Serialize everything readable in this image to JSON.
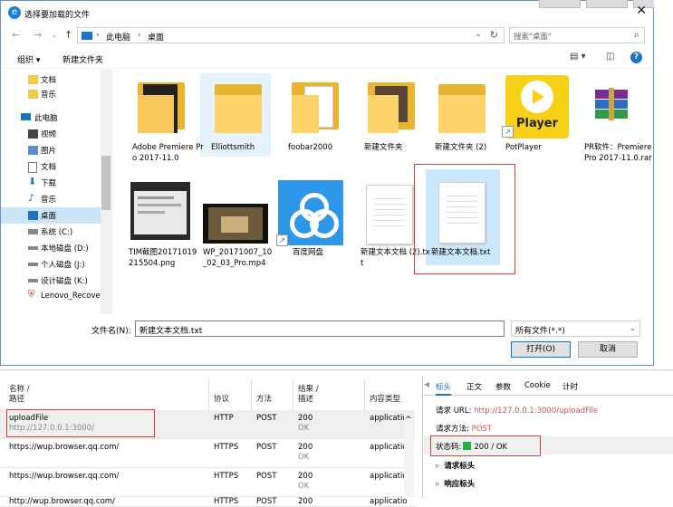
{
  "dialog": {
    "title": "选择要加载的文件",
    "close": "✕",
    "address": {
      "crumbs": [
        "此电脑",
        "桌面"
      ],
      "sep": "›"
    },
    "search_placeholder": "搜索\"桌面\"",
    "toolbar": {
      "organize": "组织 ▾",
      "new_folder": "新建文件夹"
    },
    "sidebar": [
      {
        "label": "文档",
        "icon": "folder-icon"
      },
      {
        "label": "音乐",
        "icon": "folder-icon"
      },
      {
        "label": "此电脑",
        "icon": "computer-icon"
      },
      {
        "label": "视频",
        "icon": "video-icon"
      },
      {
        "label": "图片",
        "icon": "picture-icon"
      },
      {
        "label": "文档",
        "icon": "document-icon"
      },
      {
        "label": "下载",
        "icon": "download-icon"
      },
      {
        "label": "音乐",
        "icon": "music-icon"
      },
      {
        "label": "桌面",
        "icon": "desktop-icon"
      },
      {
        "label": "系统 (C:)",
        "icon": "drive-icon"
      },
      {
        "label": "本地磁盘 (D:)",
        "icon": "drive-icon"
      },
      {
        "label": "个人磁盘 (J:)",
        "icon": "drive-icon"
      },
      {
        "label": "设计磁盘 (K:)",
        "icon": "drive-icon"
      },
      {
        "label": "Lenovo_Recove",
        "icon": "recovery-drive-icon"
      }
    ],
    "files": [
      {
        "name": "Adobe Premiere Pro 2017-11.0"
      },
      {
        "name": "Elliottsmith"
      },
      {
        "name": "foobar2000"
      },
      {
        "name": "新建文件夹"
      },
      {
        "name": "新建文件夹 (2)"
      },
      {
        "name": "PotPlayer",
        "logo_text": "Player"
      },
      {
        "name": "PR软件：Premiere Pro 2017-11.0.rar"
      },
      {
        "name": "TIM截图20171019215504.png"
      },
      {
        "name": "WP_20171007_10_02_03_Pro.mp4"
      },
      {
        "name": "百度网盘"
      },
      {
        "name": "新建文本文档 (2).txt"
      },
      {
        "name": "新建文本文档.txt"
      }
    ],
    "filename_label": "文件名(N):",
    "filename_value": "新建文本文档.txt",
    "filetype_value": "所有文件(*.*)",
    "open_button": "打开(O)",
    "cancel_button": "取消"
  },
  "network": {
    "headers": {
      "name": "名称 /",
      "path": "路径",
      "protocol": "协议",
      "method": "方法",
      "result": "结果 /",
      "desc": "描述",
      "content_type": "内容类型"
    },
    "rows": [
      {
        "name": "uploadFile",
        "path": "http://127.0.0.1:3000/",
        "protocol": "HTTP",
        "method": "POST",
        "status": "200",
        "status_text": "OK",
        "type": "applicatio"
      },
      {
        "name": "https://wup.browser.qq.com/",
        "path": "",
        "protocol": "HTTPS",
        "method": "POST",
        "status": "200",
        "status_text": "OK",
        "type": "applicatio"
      },
      {
        "name": "https://wup.browser.qq.com/",
        "path": "",
        "protocol": "HTTPS",
        "method": "POST",
        "status": "200",
        "status_text": "OK",
        "type": "applicatio"
      },
      {
        "name": "http://wup.browser.qq.com/",
        "path": "",
        "protocol": "HTTPS",
        "method": "POST",
        "status": "200",
        "status_text": "",
        "type": "applicatio"
      }
    ],
    "detail": {
      "tabs": [
        "标头",
        "正文",
        "参数",
        "Cookie",
        "计时"
      ],
      "request_url_label": "请求 URL:",
      "request_url": "http://127.0.0.1:3000/uploadFile",
      "request_method_label": "请求方法:",
      "request_method": "POST",
      "status_label": "状态码:",
      "status_value": "200 / OK",
      "sections": [
        "请求标头",
        "响应标头"
      ],
      "status_color": "#2bb048"
    }
  }
}
